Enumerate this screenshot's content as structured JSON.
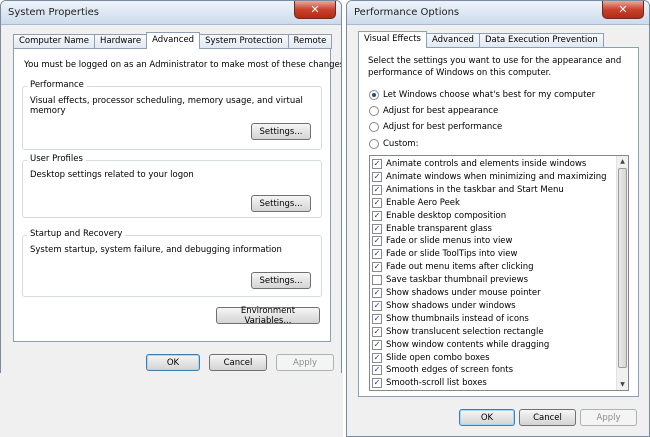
{
  "left_window": {
    "title": "System Properties",
    "close_glyph": "✕",
    "tabs": [
      "Computer Name",
      "Hardware",
      "Advanced",
      "System Protection",
      "Remote"
    ],
    "admin_note": "You must be logged on as an Administrator to make most of these changes.",
    "performance": {
      "title": "Performance",
      "desc": "Visual effects, processor scheduling, memory usage, and virtual memory",
      "button": "Settings..."
    },
    "user_profiles": {
      "title": "User Profiles",
      "desc": "Desktop settings related to your logon",
      "button": "Settings..."
    },
    "startup": {
      "title": "Startup and Recovery",
      "desc": "System startup, system failure, and debugging information",
      "button": "Settings..."
    },
    "env_button": "Environment Variables...",
    "ok": "OK",
    "cancel": "Cancel",
    "apply": "Apply"
  },
  "right_window": {
    "title": "Performance Options",
    "close_glyph": "✕",
    "tabs": [
      "Visual Effects",
      "Advanced",
      "Data Execution Prevention"
    ],
    "intro_line1": "Select the settings you want to use for the appearance and",
    "intro_line2": "performance of Windows on this computer.",
    "radios": [
      {
        "label": "Let Windows choose what's best for my computer",
        "checked": true
      },
      {
        "label": "Adjust for best appearance",
        "checked": false
      },
      {
        "label": "Adjust for best performance",
        "checked": false
      },
      {
        "label": "Custom:",
        "checked": false
      }
    ],
    "effects": [
      {
        "label": "Animate controls and elements inside windows",
        "checked": true
      },
      {
        "label": "Animate windows when minimizing and maximizing",
        "checked": true
      },
      {
        "label": "Animations in the taskbar and Start Menu",
        "checked": true
      },
      {
        "label": "Enable Aero Peek",
        "checked": true
      },
      {
        "label": "Enable desktop composition",
        "checked": true
      },
      {
        "label": "Enable transparent glass",
        "checked": true
      },
      {
        "label": "Fade or slide menus into view",
        "checked": true
      },
      {
        "label": "Fade or slide ToolTips into view",
        "checked": true
      },
      {
        "label": "Fade out menu items after clicking",
        "checked": true
      },
      {
        "label": "Save taskbar thumbnail previews",
        "checked": false
      },
      {
        "label": "Show shadows under mouse pointer",
        "checked": true
      },
      {
        "label": "Show shadows under windows",
        "checked": true
      },
      {
        "label": "Show thumbnails instead of icons",
        "checked": true
      },
      {
        "label": "Show translucent selection rectangle",
        "checked": true
      },
      {
        "label": "Show window contents while dragging",
        "checked": true
      },
      {
        "label": "Slide open combo boxes",
        "checked": true
      },
      {
        "label": "Smooth edges of screen fonts",
        "checked": true
      },
      {
        "label": "Smooth-scroll list boxes",
        "checked": true
      }
    ],
    "check_glyph": "✓",
    "scroll_up_glyph": "▲",
    "scroll_down_glyph": "▼",
    "ok": "OK",
    "cancel": "Cancel",
    "apply": "Apply"
  }
}
